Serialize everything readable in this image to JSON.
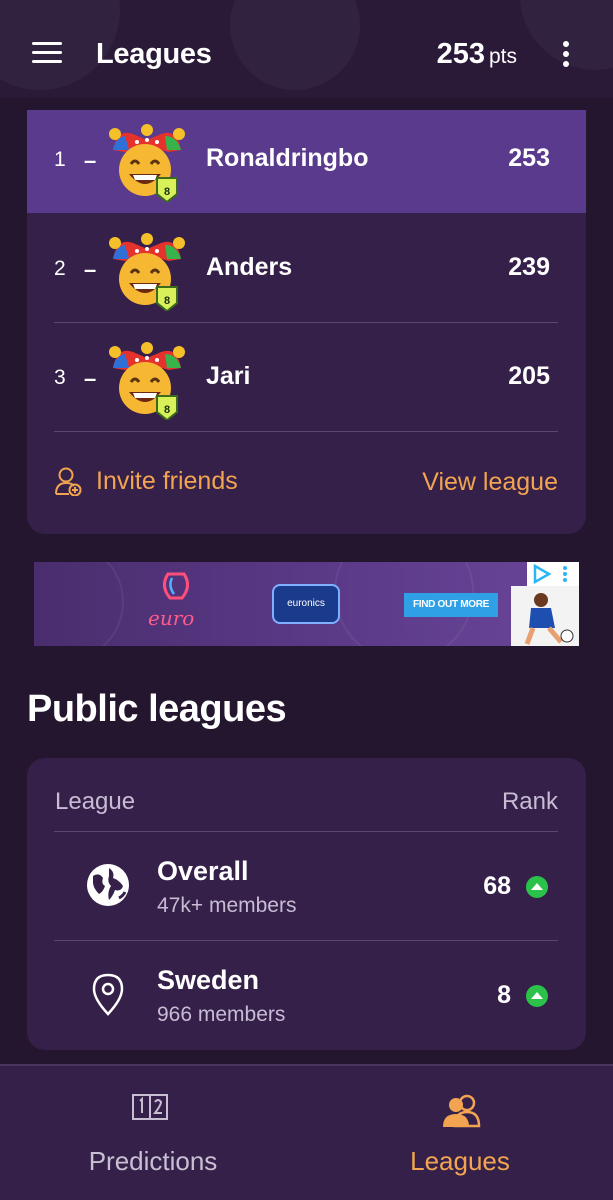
{
  "header": {
    "title": "Leagues",
    "points": "253",
    "points_unit": "pts"
  },
  "league": {
    "rows": [
      {
        "rank": "1",
        "dash": "–",
        "name": "Ronaldringbo",
        "points": "253",
        "badge": "8"
      },
      {
        "rank": "2",
        "dash": "–",
        "name": "Anders",
        "points": "239",
        "badge": "8"
      },
      {
        "rank": "3",
        "dash": "–",
        "name": "Jari",
        "points": "205",
        "badge": "8"
      }
    ],
    "invite_label": "Invite friends",
    "view_label": "View league"
  },
  "ad": {
    "euronics": "euronics",
    "cta": "FIND OUT MORE",
    "euro_script": "euro"
  },
  "public_leagues": {
    "title": "Public leagues",
    "col_league": "League",
    "col_rank": "Rank",
    "rows": [
      {
        "name": "Overall",
        "members": "47k+ members",
        "rank": "68",
        "icon": "globe-icon",
        "trend": "up"
      },
      {
        "name": "Sweden",
        "members": "966 members",
        "rank": "8",
        "icon": "location-pin-icon",
        "trend": "up"
      }
    ]
  },
  "bottom_nav": {
    "predictions_label": "Predictions",
    "leagues_label": "Leagues"
  },
  "colors": {
    "accent": "#f2a450",
    "highlight_row": "#5a3a8c",
    "card": "#35204a",
    "trend_up": "#2bc24a"
  }
}
